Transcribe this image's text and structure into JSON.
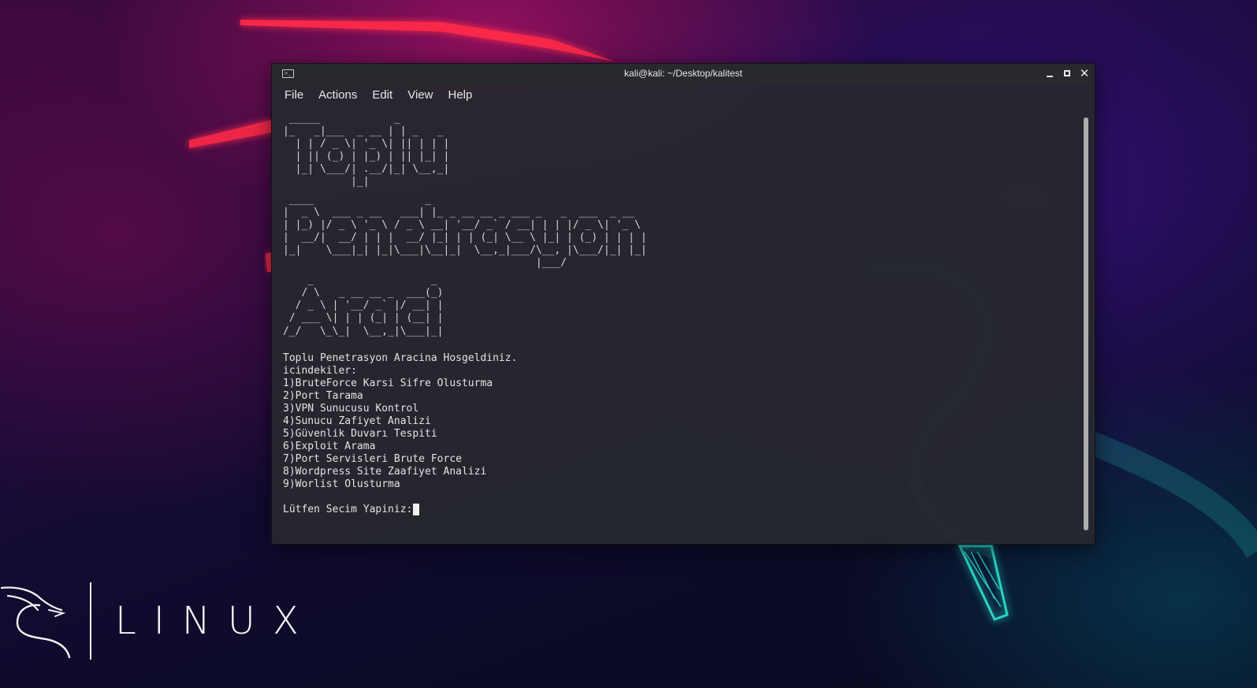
{
  "desktop": {
    "brand_text": "LINUX",
    "brand_logo_icon": "kali-dragon-icon"
  },
  "window": {
    "title": "kali@kali: ~/Desktop/kalitest",
    "app_icon": "terminal-icon",
    "controls": {
      "minimize_icon": "minimize-icon",
      "maximize_icon": "maximize-icon",
      "close_icon": "close-icon",
      "close_glyph": "✕"
    },
    "menu": [
      {
        "label": "File"
      },
      {
        "label": "Actions"
      },
      {
        "label": "Edit"
      },
      {
        "label": "View"
      },
      {
        "label": "Help"
      }
    ]
  },
  "terminal": {
    "ascii_banner": [
      [
        " _____            _       ",
        "|_   _|___  _ __ | | _   _ ",
        "  | | / _ \\| '_ \\| || | | |",
        "  | || (_) | |_) | || |_| |",
        "  |_| \\___/| .__/|_| \\__,_|",
        "           |_|             "
      ],
      [
        " ____                  _                                          ",
        "|  _ \\  ___ _ __   ___| |_ _ __ __ _ ___ _   _  ___  _ __  ",
        "| |_) |/ _ \\ '_ \\ / _ \\ __| '__/ _` / __| | | |/ _ \\| '_ \\ ",
        "|  __/|  __/ | | |  __/ |_| | | (_| \\__ \\ |_| | (_) | | | |",
        "|_|    \\___|_| |_|\\___|\\__|_|  \\__,_|___/\\__, |\\___/|_| |_|",
        "                                         |___/             "
      ],
      [
        "    _                   _ ",
        "   / \\   _ __ __ _  ___(_)",
        "  / _ \\ | '__/ _` |/ __| |",
        " / ___ \\| | | (_| | (__| |",
        "/_/   \\_\\_|  \\__,_|\\___|_|"
      ]
    ],
    "welcome": "Toplu Penetrasyon Aracina Hosgeldiniz.",
    "contents_label": "icindekiler:",
    "options": [
      "1)BruteForce Karsi Sifre Olusturma",
      "2)Port Tarama",
      "3)VPN Sunucusu Kontrol",
      "4)Sunucu Zafiyet Analizi",
      "5)Güvenlik Duvarı Tespiti",
      "6)Exploit Arama",
      "7)Port Servisleri Brute Force",
      "8)Wordpress Site Zaafiyet Analizi",
      "9)Worlist Olusturma"
    ],
    "prompt": "Lütfen Secim Yapiniz:"
  },
  "colors": {
    "terminal_bg": "#26282e",
    "terminal_text": "#e4e4e4",
    "neon_red": "#ff2a4a",
    "neon_cyan": "#2ee6d6"
  }
}
